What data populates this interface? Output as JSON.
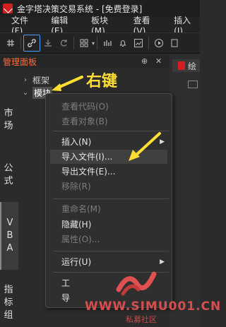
{
  "window": {
    "title": "金字塔决策交易系统 - [免费登录]"
  },
  "menubar": [
    "文件(F)",
    "编辑(E)",
    "板块(M)",
    "查看(V)",
    "插入(I)"
  ],
  "toolbar": {
    "icons": [
      "grid-icon",
      "link-icon",
      "download-icon",
      "refresh-icon",
      "layout-icon",
      "chart-icon",
      "bell-icon",
      "line-chart-icon",
      "play-icon",
      "doc-icon"
    ]
  },
  "panel": {
    "title": "管理面板",
    "pin_glyph": "⊕",
    "close_glyph": "✕",
    "side_tabs": [
      {
        "label": "市场",
        "chars": [
          "市",
          "场"
        ]
      },
      {
        "label": "公式",
        "chars": [
          "公",
          "式"
        ]
      },
      {
        "label": "VBA",
        "chars": [
          "V",
          "B",
          "A"
        ]
      },
      {
        "label": "指标组",
        "chars": [
          "指",
          "标",
          "组"
        ]
      }
    ],
    "tree": [
      {
        "label": "框架",
        "expanded": false
      },
      {
        "label": "模块",
        "expanded": true,
        "selected": true
      }
    ]
  },
  "context_menu": {
    "items": [
      {
        "label": "查看代码(O)",
        "enabled": false
      },
      {
        "label": "查看对象(B)",
        "enabled": false
      },
      {
        "label": "插入(N)",
        "enabled": true,
        "submenu": true
      },
      {
        "label": "导入文件(I)...",
        "enabled": true,
        "highlighted": true
      },
      {
        "label": "导出文件(E)...",
        "enabled": true
      },
      {
        "label": "移除(R)",
        "enabled": false
      },
      {
        "label": "重命名(M)",
        "enabled": false
      },
      {
        "label": "隐藏(H)",
        "enabled": true
      },
      {
        "label": "属性(O)...",
        "enabled": false
      },
      {
        "label": "运行(U)",
        "enabled": true,
        "submenu": true
      },
      {
        "label": "工",
        "enabled": true
      },
      {
        "label": "导",
        "enabled": true
      }
    ]
  },
  "annotation": {
    "text": "右键",
    "color": "#ffde33"
  },
  "watermark": {
    "text": "WWW.SIMU001.CN",
    "subtext": "私募社区",
    "color": "#e05050"
  },
  "doc_tab": {
    "label": "绘"
  }
}
